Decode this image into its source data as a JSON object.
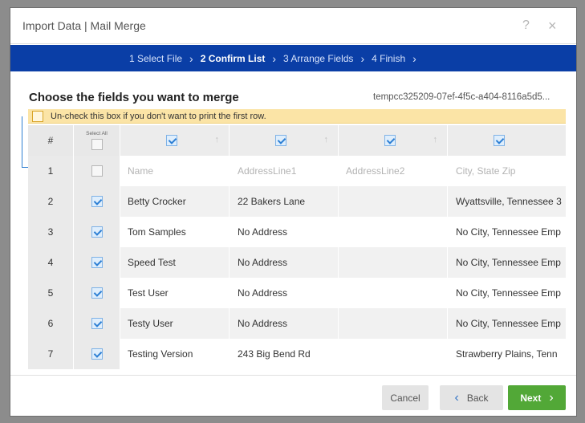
{
  "dialog": {
    "title": "Import Data | Mail Merge",
    "help_icon": "?",
    "close_icon": "×"
  },
  "wizard": {
    "steps": [
      {
        "label": "1 Select File",
        "active": false
      },
      {
        "label": "2 Confirm List",
        "active": true
      },
      {
        "label": "3 Arrange Fields",
        "active": false
      },
      {
        "label": "4 Finish",
        "active": false
      }
    ],
    "separator": "›"
  },
  "main": {
    "heading": "Choose the fields you want to merge",
    "filename": "tempcc325209-07ef-4f5c-a404-8116a5d5...",
    "notice": "Un-check this box if you don't want to print the first row."
  },
  "grid": {
    "num_header": "#",
    "select_all_label": "Select All",
    "sort_icon": "↑",
    "rows": [
      {
        "num": "1",
        "checked": false,
        "cells": [
          "Name",
          "AddressLine1",
          "AddressLine2",
          "City, State Zip"
        ]
      },
      {
        "num": "2",
        "checked": true,
        "cells": [
          "Betty Crocker",
          "22 Bakers Lane",
          "",
          "Wyattsville, Tennessee 3"
        ]
      },
      {
        "num": "3",
        "checked": true,
        "cells": [
          "Tom Samples",
          "No Address",
          "",
          "No City, Tennessee Emp"
        ]
      },
      {
        "num": "4",
        "checked": true,
        "cells": [
          "Speed Test",
          "No Address",
          "",
          "No City, Tennessee Emp"
        ]
      },
      {
        "num": "5",
        "checked": true,
        "cells": [
          "Test User",
          "No Address",
          "",
          "No City, Tennessee Emp"
        ]
      },
      {
        "num": "6",
        "checked": true,
        "cells": [
          "Testy User",
          "No Address",
          "",
          "No City, Tennessee Emp"
        ]
      },
      {
        "num": "7",
        "checked": true,
        "cells": [
          "Testing Version",
          "243 Big Bend Rd",
          "",
          "Strawberry Plains, Tenn"
        ]
      }
    ]
  },
  "footer": {
    "cancel_label": "Cancel",
    "back_label": "Back",
    "next_label": "Next",
    "back_icon": "‹",
    "next_icon": "›"
  },
  "colors": {
    "wizard_bar": "#0a3ea6",
    "next_button": "#52a837",
    "notice_bg": "#fbe4a6",
    "check_accent": "#2d7fd4"
  }
}
